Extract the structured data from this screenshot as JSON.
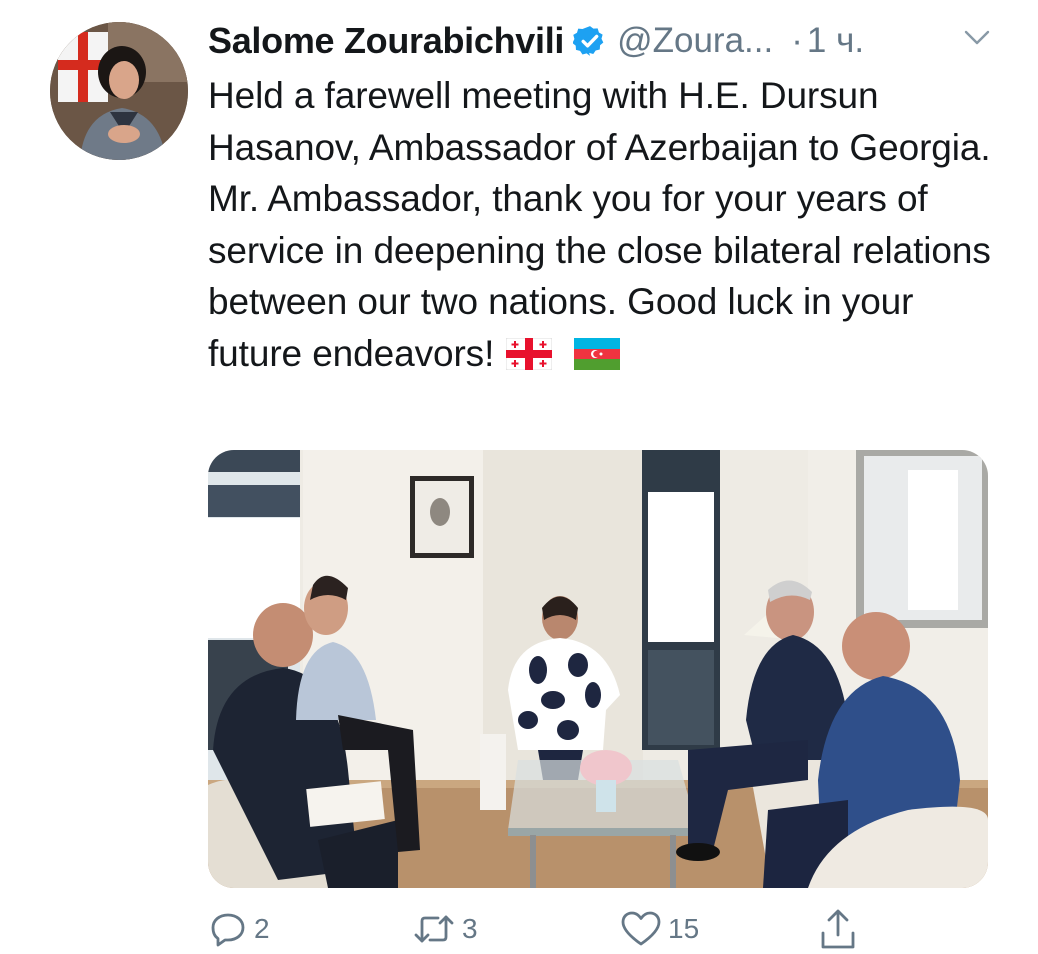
{
  "tweet": {
    "author_name": "Salome Zourabichvili",
    "handle": "@Zoura...",
    "separator": "·",
    "time": "1 ч.",
    "text_main": "Held a farewell meeting with H.E. Dursun Hasanov, Ambassador of Azerbaijan to Georgia. Mr. Ambassador, thank you for your years of service in deepening the close bilateral relations between our two nations. Good luck in your future endeavors!",
    "flags": [
      "georgia-flag-icon",
      "azerbaijan-flag-icon"
    ]
  },
  "actions": {
    "reply_count": "2",
    "retweet_count": "3",
    "like_count": "15"
  },
  "colors": {
    "text": "#14171a",
    "secondary": "#657786",
    "verified": "#1da1f2"
  }
}
